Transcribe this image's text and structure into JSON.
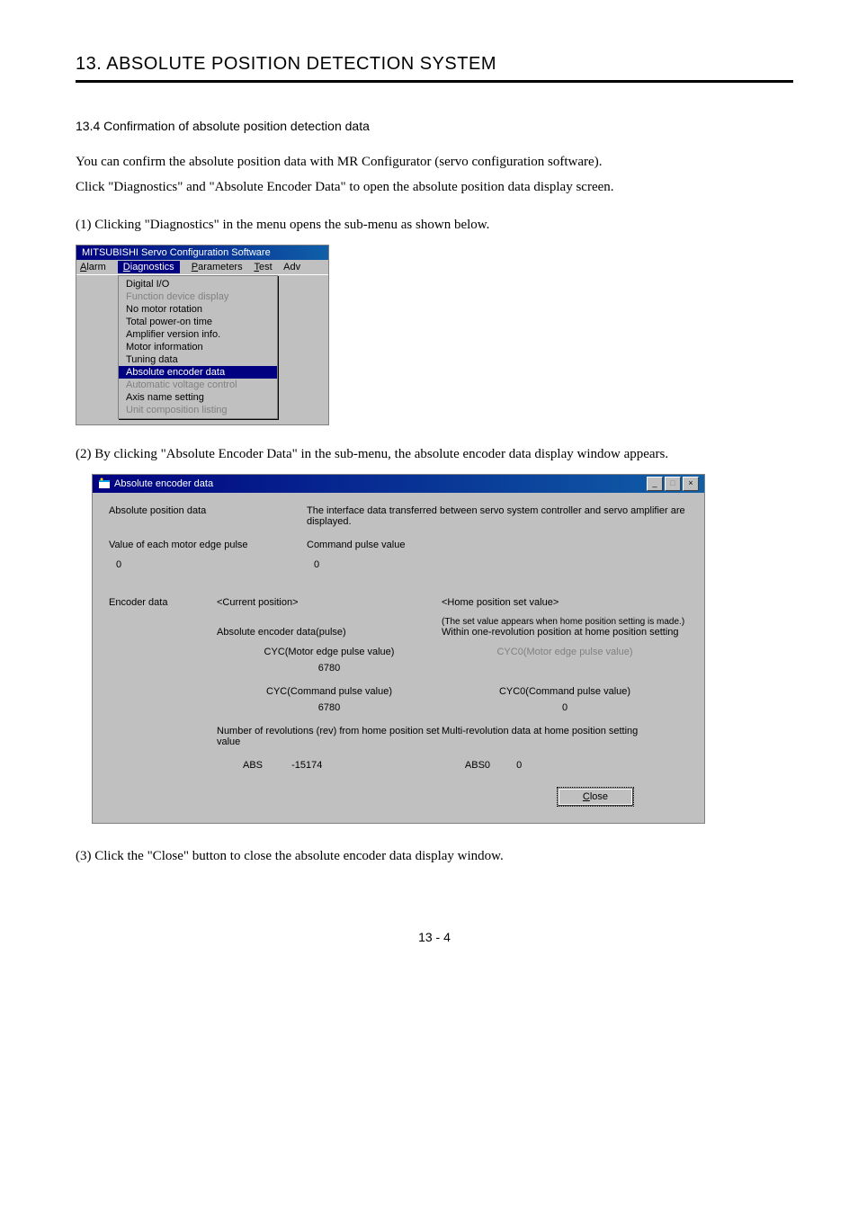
{
  "chapter": "13. ABSOLUTE POSITION DETECTION SYSTEM",
  "section": "13.4 Confirmation of absolute position detection data",
  "intro1": "You can confirm the absolute position data with MR Configurator (servo configuration software).",
  "intro2": "Click \"Diagnostics\" and \"Absolute Encoder Data\" to open the absolute position data display screen.",
  "step1": "(1) Clicking \"Diagnostics\" in the menu opens the sub-menu as shown below.",
  "step2": "(2) By clicking \"Absolute Encoder Data\" in the sub-menu, the absolute encoder data display window appears.",
  "step3": "(3) Click the \"Close\" button to close the absolute encoder data display window.",
  "page_num": "13 -  4",
  "smallui": {
    "title": "MITSUBISHI Servo Configuration Software",
    "menus": {
      "alarm": "Alarm",
      "diag": "Diagnostics",
      "param": "Parameters",
      "test": "Test",
      "adv": "Adv"
    },
    "items": {
      "i0": "Digital I/O",
      "i1": "Function device display",
      "i2": "No motor rotation",
      "i3": "Total power-on time",
      "i4": "Amplifier version info.",
      "i5": "Motor information",
      "i6": "Tuning data",
      "i7": "Absolute encoder data",
      "i8": "Automatic voltage control",
      "i9": "Axis name setting",
      "i10": "Unit composition listing"
    }
  },
  "dialog": {
    "title": "Absolute encoder data",
    "abs_pos_label": "Absolute position data",
    "abs_pos_desc": "The interface data transferred between servo system controller and servo amplifier are displayed.",
    "edge_label": "Value of each motor edge pulse",
    "cmd_label": "Command pulse value",
    "edge_val": "0",
    "cmd_val": "0",
    "enc_label": "Encoder data",
    "cur_pos": "<Current position>",
    "home_pos": "<Home position set value>",
    "home_note": "(The set value appears when home position setting is made.)",
    "abs_enc_label": "Absolute encoder data(pulse)",
    "home_one_rev": "Within one-revolution position at home position setting",
    "cyc_m_lbl": "CYC(Motor edge pulse value)",
    "cyc_m_val": "6780",
    "cyc0_m_lbl": "CYC0(Motor edge pulse value)",
    "cyc_c_lbl": "CYC(Command pulse value)",
    "cyc_c_val": "6780",
    "cyc0_c_lbl": "CYC0(Command pulse value)",
    "cyc0_c_val": "0",
    "rev_lbl": "Number of revolutions (rev) from home position set value",
    "multi_lbl": "Multi-revolution data at home position setting",
    "abs_lbl": "ABS",
    "abs_val": "-15174",
    "abs0_lbl": "ABS0",
    "abs0_val": "0",
    "close": "Close"
  }
}
